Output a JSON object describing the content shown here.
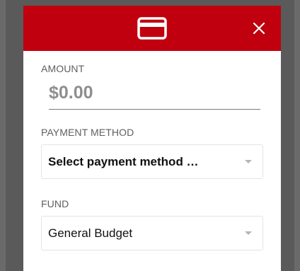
{
  "dialog": {
    "header_icon": "credit-card-icon",
    "close_icon": "close-icon",
    "brand_color": "#c0000f"
  },
  "amount": {
    "label": "AMOUNT",
    "placeholder": "$0.00"
  },
  "payment_method": {
    "label": "PAYMENT METHOD",
    "selected": "Select payment method …"
  },
  "fund": {
    "label": "FUND",
    "selected": "General Budget"
  }
}
